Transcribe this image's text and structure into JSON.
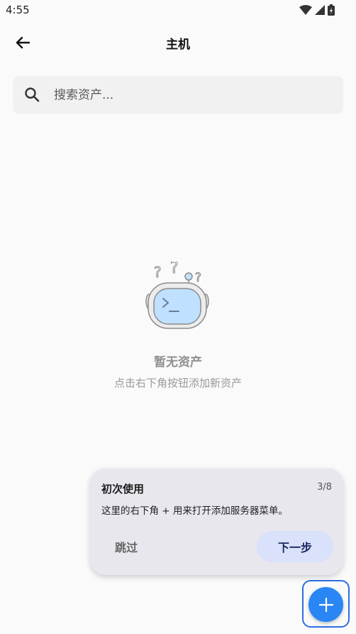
{
  "status_bar": {
    "time": "4:55"
  },
  "app_bar": {
    "title": "主机"
  },
  "search": {
    "placeholder": "搜索资产..."
  },
  "empty_state": {
    "title": "暂无资产",
    "subtitle": "点击右下角按钮添加新资产"
  },
  "coach_mark": {
    "title": "初次使用",
    "step": "3/8",
    "body": "这里的右下角 + 用来打开添加服务器菜单。",
    "skip_label": "跳过",
    "next_label": "下一步"
  },
  "icons": {
    "back": "arrow-left-icon",
    "search": "search-icon",
    "fab": "plus-icon"
  },
  "colors": {
    "fab": "#2a86f5",
    "next_button": "#d9e1fb",
    "coach_card": "#e9e7ee"
  }
}
